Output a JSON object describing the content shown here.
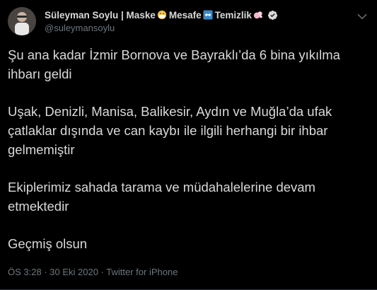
{
  "author": {
    "display_name_parts": [
      "Süleyman Soylu | Maske",
      "Mesafe",
      "Temizlik"
    ],
    "handle": "@suleymansoylu",
    "emoji_icons": [
      "mask-emoji-icon",
      "left-right-arrow-emoji-icon",
      "soap-emoji-icon"
    ]
  },
  "tweet": {
    "paragraphs": [
      "Şu ana kadar İzmir Bornova ve Bayraklı’da 6 bina yıkılma ihbarı geldi",
      "Uşak, Denizli, Manisa, Balikesir, Aydın ve Muğla’da ufak çatlaklar dışında ve can kaybı ile ilgili herhangi bir ihbar gelmemiştir",
      "Ekiplerimiz sahada tarama ve müdahalelerine devam etmektedir",
      "Geçmiş olsun"
    ]
  },
  "meta": {
    "time": "ÖS 3:28",
    "separator1": " · ",
    "date": "30 Eki 2020",
    "separator2": " · ",
    "source": "Twitter for iPhone"
  },
  "colors": {
    "background": "#000000",
    "text": "#d9d9d9",
    "secondary": "#6e767d",
    "verified_badge": "#d9d9d9"
  }
}
